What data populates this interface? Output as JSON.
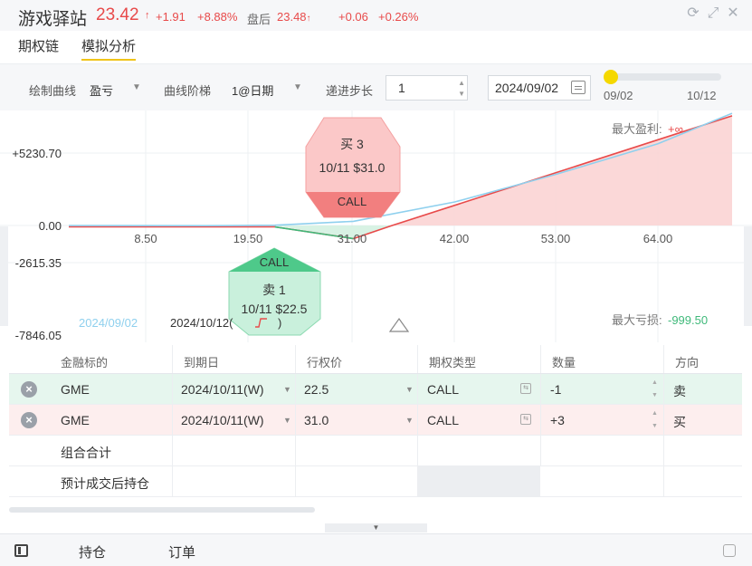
{
  "header": {
    "name": "游戏驿站",
    "price": "23.42",
    "price_arrow": "↑",
    "change": "+1.91",
    "change_pct": "+8.88%",
    "after_hours_label": "盘后",
    "after_hours_price": "23.48",
    "after_hours_arrow": "↑",
    "after_hours_change": "+0.06",
    "after_hours_pct": "+0.26%",
    "icons": [
      "refresh-icon",
      "fullscreen-icon",
      "close-icon"
    ],
    "up_color": "#e84a4a"
  },
  "tabs": [
    {
      "label": "期权链",
      "active": false
    },
    {
      "label": "模拟分析",
      "active": true
    }
  ],
  "controls": {
    "curve_label": "绘制曲线",
    "curve_value": "盈亏",
    "ladder_label": "曲线阶梯",
    "ladder_value": "1@日期",
    "step_label": "递进步长",
    "step_value": "1",
    "date_value": "2024/09/02",
    "slider_min": "09/02",
    "slider_max": "10/12",
    "slider_position": 0
  },
  "chart_data": {
    "type": "line",
    "y_ticks": [
      "+5230.70",
      "0.00",
      "-2615.35",
      "-7846.05"
    ],
    "x_ticks": [
      "8.50",
      "19.50",
      "31.00",
      "42.00",
      "53.00",
      "64.00"
    ],
    "max_profit_label": "最大盈利:",
    "max_profit_value": "+∞",
    "max_loss_label": "最大亏损:",
    "max_loss_value": "-999.50",
    "legend_date_1": "2024/09/02",
    "legend_date_2": "2024/10/12(",
    "legend_date_2_suffix": ")",
    "series": [
      {
        "name": "2024/10/12",
        "color": "#e84a4a",
        "x": [
          0,
          22.5,
          31.0,
          35.2,
          75
        ],
        "y": [
          -99.5,
          -99.5,
          -949.5,
          0,
          7920
        ]
      },
      {
        "name": "2024/09/02",
        "color": "#8fd0ee",
        "x": [
          0,
          15,
          22.5,
          31.0,
          42.0,
          53.0,
          64.0,
          75
        ],
        "y": [
          0,
          -10,
          20,
          300,
          1700,
          3700,
          5900,
          8100
        ]
      }
    ],
    "markers": [
      {
        "side": "买",
        "qty": "3",
        "expiry": "10/11",
        "strike": "$31.0",
        "type": "CALL",
        "color": "#f08080"
      },
      {
        "side": "卖",
        "qty": "1",
        "expiry": "10/11",
        "strike": "$22.5",
        "type": "CALL",
        "color": "#4ec98a"
      }
    ]
  },
  "table": {
    "headers": [
      "金融标的",
      "到期日",
      "行权价",
      "期权类型",
      "数量",
      "方向"
    ],
    "rows": [
      {
        "symbol": "GME",
        "expiry": "2024/10/11(W)",
        "strike": "22.5",
        "type": "CALL",
        "qty": "-1",
        "direction": "卖"
      },
      {
        "symbol": "GME",
        "expiry": "2024/10/11(W)",
        "strike": "31.0",
        "type": "CALL",
        "qty": "+3",
        "direction": "买"
      }
    ],
    "total_label": "组合合计",
    "projected_label": "预计成交后持仓"
  },
  "footer": {
    "positions": "持仓",
    "orders": "订单"
  }
}
